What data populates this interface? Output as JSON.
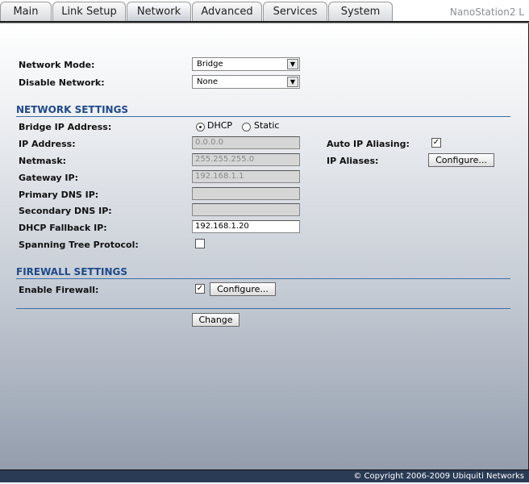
{
  "tabs": [
    "Main",
    "Link Setup",
    "Network",
    "Advanced",
    "Services",
    "System"
  ],
  "active_tab": "Network",
  "brand": "NanoStation2 L",
  "network_mode": {
    "label": "Network Mode:",
    "value": "Bridge"
  },
  "disable_network": {
    "label": "Disable Network:",
    "value": "None"
  },
  "network_settings": {
    "title": "NETWORK SETTINGS",
    "bridge_ip_label": "Bridge IP Address:",
    "dhcp_label": "DHCP",
    "static_label": "Static",
    "selected": "DHCP",
    "ip_label": "IP Address:",
    "ip_value": "0.0.0.0",
    "netmask_label": "Netmask:",
    "netmask_value": "255.255.255.0",
    "gateway_label": "Gateway IP:",
    "gateway_value": "192.168.1.1",
    "dns1_label": "Primary DNS IP:",
    "dns1_value": "",
    "dns2_label": "Secondary DNS IP:",
    "dns2_value": "",
    "fallback_label": "DHCP Fallback IP:",
    "fallback_value": "192.168.1.20",
    "stp_label": "Spanning Tree Protocol:",
    "stp_checked": false,
    "auto_alias_label": "Auto IP Aliasing:",
    "auto_alias_checked": true,
    "aliases_label": "IP Aliases:",
    "configure_label": "Configure..."
  },
  "firewall": {
    "title": "FIREWALL SETTINGS",
    "enable_label": "Enable Firewall:",
    "enabled": true,
    "configure_label": "Configure..."
  },
  "change_label": "Change",
  "footer": "© Copyright 2006-2009 Ubiquiti Networks"
}
